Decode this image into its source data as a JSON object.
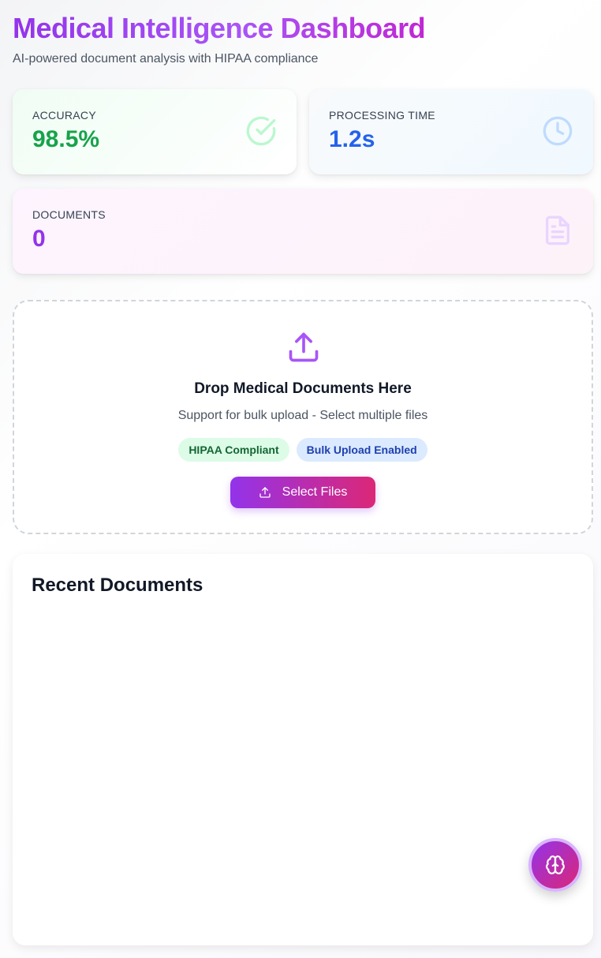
{
  "header": {
    "title": "Medical Intelligence Dashboard",
    "subtitle": "AI-powered document analysis with HIPAA compliance"
  },
  "stats": {
    "accuracy": {
      "label": "ACCURACY",
      "value": "98.5%",
      "color": "#16a34a",
      "icon": "check-circle-icon"
    },
    "processing_time": {
      "label": "PROCESSING TIME",
      "value": "1.2s",
      "color": "#2563eb",
      "icon": "clock-icon"
    },
    "documents": {
      "label": "DOCUMENTS",
      "value": "0",
      "color": "#9333ea",
      "icon": "file-text-icon"
    }
  },
  "upload": {
    "title": "Drop Medical Documents Here",
    "subtitle": "Support for bulk upload - Select multiple files",
    "badges": [
      {
        "label": "HIPAA Compliant"
      },
      {
        "label": "Bulk Upload Enabled"
      }
    ],
    "button_label": "Select Files",
    "icon": "upload-icon"
  },
  "recent": {
    "title": "Recent Documents",
    "items": []
  },
  "fab": {
    "icon": "brain-icon"
  }
}
